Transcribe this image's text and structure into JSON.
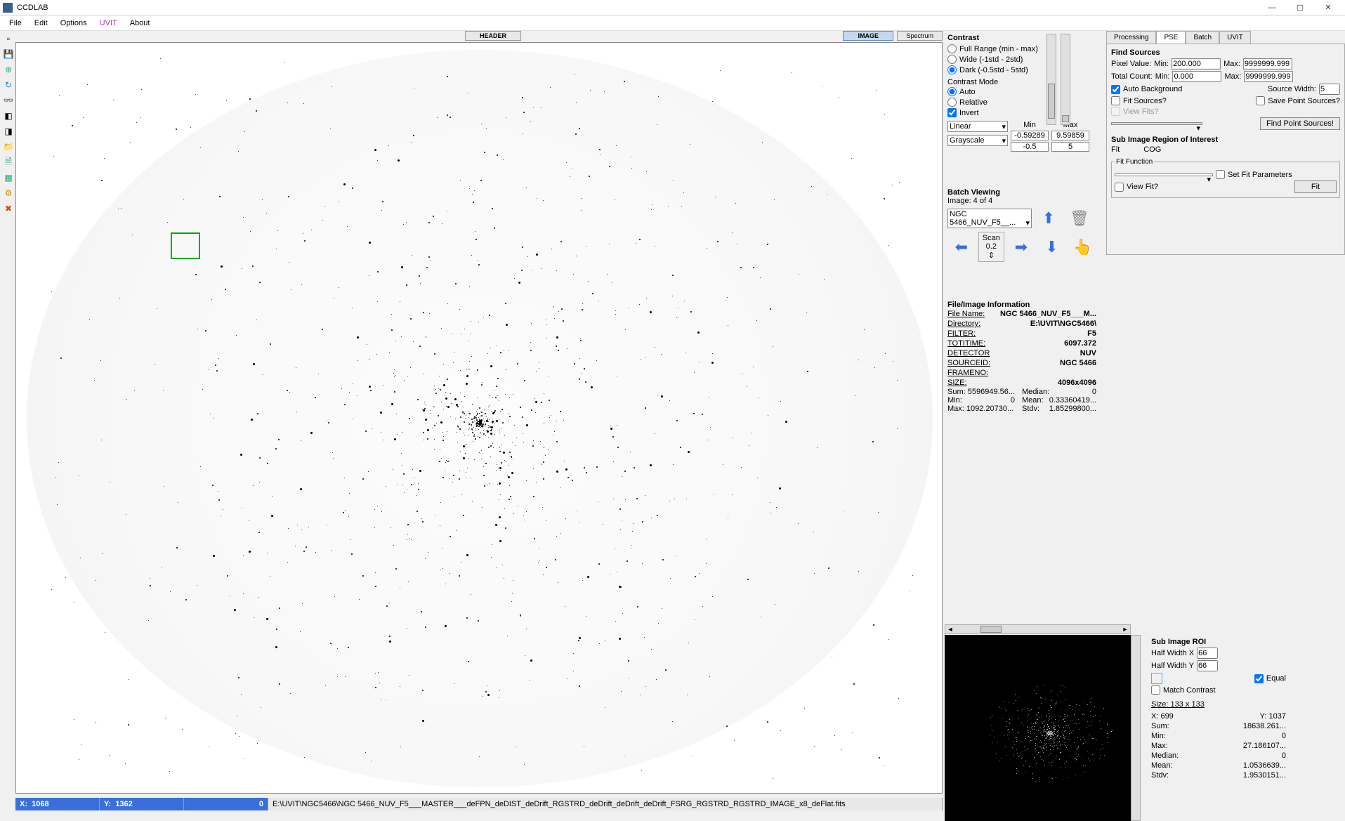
{
  "window": {
    "title": "CCDLAB"
  },
  "menus": [
    "File",
    "Edit",
    "Options",
    "UVIT",
    "About"
  ],
  "tabs": {
    "header": "HEADER",
    "image": "IMAGE",
    "spectrum": "Spectrum"
  },
  "status": {
    "x_label": "X:",
    "x": "1068",
    "y_label": "Y:",
    "y": "1362",
    "z": "0",
    "path": "E:\\UVIT\\NGC5466\\NGC 5466_NUV_F5___MASTER___deFPN_deDIST_deDrift_RGSTRD_deDrift_deDrift_deDrift_FSRG_RGSTRD_RGSTRD_IMAGE_x8_deFlat.fits"
  },
  "contrast": {
    "title": "Contrast",
    "opts": {
      "full": "Full Range (min - max)",
      "wide": "Wide (-1std - 2std)",
      "dark": "Dark (-0.5std - 5std)"
    },
    "mode_title": "Contrast Mode",
    "auto": "Auto",
    "relative": "Relative",
    "invert": "Invert",
    "scale": "Linear",
    "colormap": "Grayscale",
    "min_label": "Min",
    "max_label": "Max",
    "min_val": "-0.59289",
    "max_val": "9.59859",
    "min_round": "-0.5",
    "max_round": "5"
  },
  "batch": {
    "title": "Batch Viewing",
    "count": "Image: 4 of 4",
    "file": "NGC 5466_NUV_F5__...",
    "scan_label": "Scan",
    "scan_val": "0.2"
  },
  "fileinfo": {
    "title": "File/Image Information",
    "rows": [
      {
        "l": "File Name:",
        "v": "NGC 5466_NUV_F5___M..."
      },
      {
        "l": "Directory:",
        "v": "E:\\UVIT\\NGC5466\\"
      },
      {
        "l": "FILTER:",
        "v": "F5"
      },
      {
        "l": "TOTITIME:",
        "v": "6097.372"
      },
      {
        "l": "DETECTOR",
        "v": "NUV"
      },
      {
        "l": "SOURCEID:",
        "v": "NGC 5466"
      },
      {
        "l": "FRAMENO:",
        "v": ""
      },
      {
        "l": "SIZE:",
        "v": "4096x4096"
      }
    ],
    "stats": {
      "sum_l": "Sum:",
      "sum": "5596949.56...",
      "med_l": "Median:",
      "med": "0",
      "min_l": "Min:",
      "min": "0",
      "mean_l": "Mean:",
      "mean": "0.33360419...",
      "max_l": "Max:",
      "max": "1092.20730...",
      "stdv_l": "Stdv:",
      "stdv": "1.85299800..."
    }
  },
  "pse_tabs": [
    "Processing",
    "PSE",
    "Batch",
    "UVIT"
  ],
  "pse": {
    "find_title": "Find Sources",
    "pixel_value": "Pixel Value:",
    "min_l": "Min:",
    "max_l": "Max:",
    "pv_min": "200.000",
    "pv_max": "9999999.999",
    "total_count": "Total Count:",
    "tc_min": "0.000",
    "tc_max": "9999999.999",
    "auto_bg": "Auto Background",
    "src_width_l": "Source Width:",
    "src_width": "5",
    "fit_sources": "Fit Sources?",
    "save_ps": "Save Point Sources?",
    "view_fits": "View Fits?",
    "find_btn": "Find Point Sources!",
    "roi_title": "Sub Image Region of Interest",
    "fit_l": "Fit",
    "cog": "COG",
    "fitfn_title": "Fit Function",
    "set_params": "Set Fit Parameters",
    "view_fit": "View Fit?",
    "fit_btn": "Fit"
  },
  "subroi": {
    "title": "Sub Image ROI",
    "hwx_l": "Half Width X",
    "hwx": "66",
    "hwy_l": "Half Width Y",
    "hwy": "66",
    "equal": "Equal",
    "match": "Match Contrast",
    "size_l": "Size: 133 x 133",
    "rows": [
      {
        "l": "X:",
        "v": "699",
        "l2": "Y:",
        "v2": "1037"
      },
      {
        "l": "Sum:",
        "v": "18638.261..."
      },
      {
        "l": "Min:",
        "v": "0"
      },
      {
        "l": "Max:",
        "v": "27.186107..."
      },
      {
        "l": "Median:",
        "v": "0"
      },
      {
        "l": "Mean:",
        "v": "1.0536639..."
      },
      {
        "l": "Stdv:",
        "v": "1.9530151..."
      }
    ]
  }
}
